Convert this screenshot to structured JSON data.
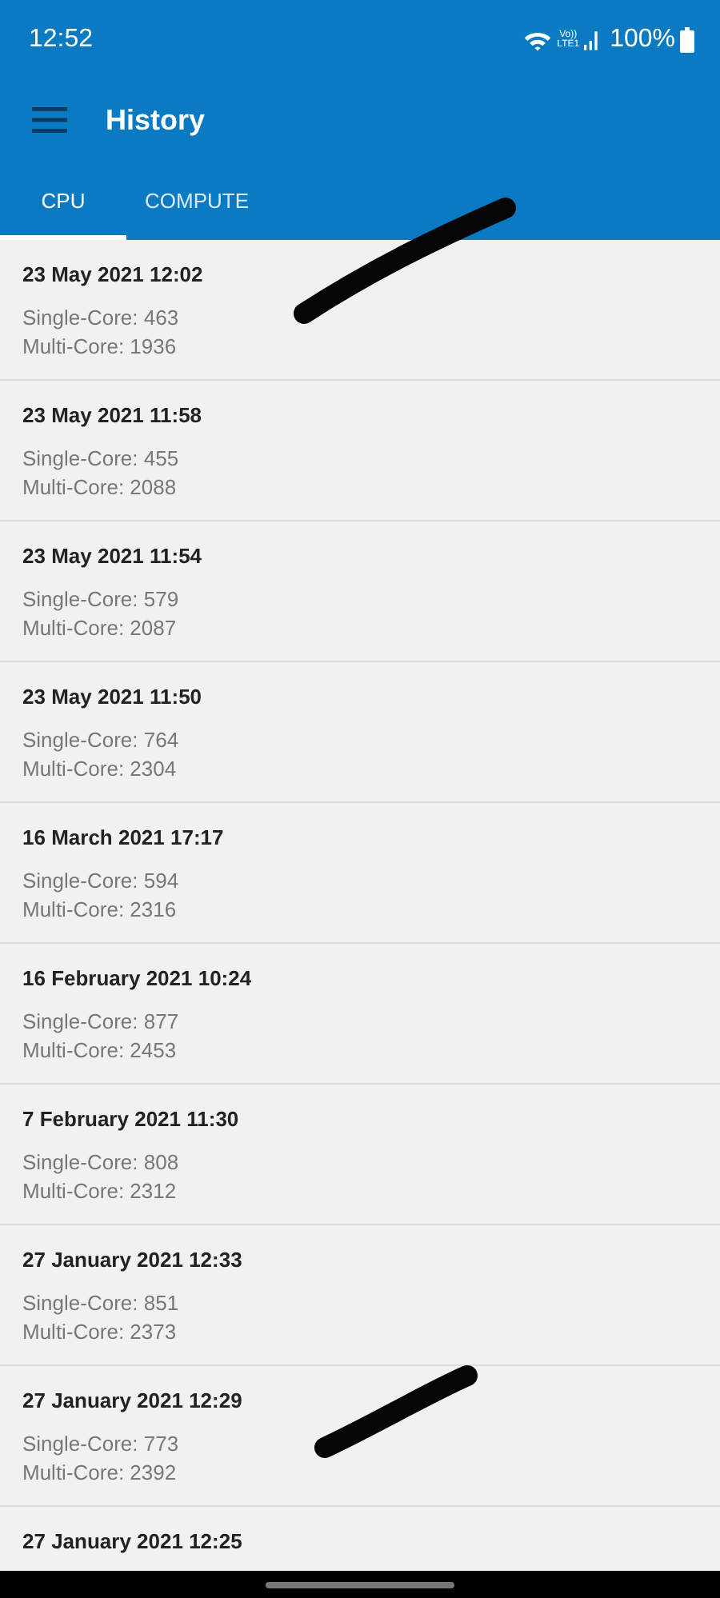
{
  "status_bar": {
    "time": "12:52",
    "network_label": [
      "Vo))",
      "LTE1"
    ],
    "battery": "100%"
  },
  "app_bar": {
    "title": "History"
  },
  "tabs": [
    {
      "label": "CPU",
      "selected": true
    },
    {
      "label": "COMPUTE",
      "selected": false
    }
  ],
  "results": [
    {
      "date": "23 May 2021 12:02",
      "single": "Single-Core: 463",
      "multi": "Multi-Core: 1936"
    },
    {
      "date": "23 May 2021 11:58",
      "single": "Single-Core: 455",
      "multi": "Multi-Core: 2088"
    },
    {
      "date": "23 May 2021 11:54",
      "single": "Single-Core: 579",
      "multi": "Multi-Core: 2087"
    },
    {
      "date": "23 May 2021 11:50",
      "single": "Single-Core: 764",
      "multi": "Multi-Core: 2304"
    },
    {
      "date": "16 March 2021 17:17",
      "single": "Single-Core: 594",
      "multi": "Multi-Core: 2316"
    },
    {
      "date": "16 February 2021 10:24",
      "single": "Single-Core: 877",
      "multi": "Multi-Core: 2453"
    },
    {
      "date": "7 February 2021 11:30",
      "single": "Single-Core: 808",
      "multi": "Multi-Core: 2312"
    },
    {
      "date": "27 January 2021 12:33",
      "single": "Single-Core: 851",
      "multi": "Multi-Core: 2373"
    },
    {
      "date": "27 January 2021 12:29",
      "single": "Single-Core: 773",
      "multi": "Multi-Core: 2392"
    },
    {
      "date": "27 January 2021 12:25"
    }
  ],
  "scribbles": [
    {
      "kind": "stroke"
    },
    {
      "kind": "stroke"
    }
  ]
}
